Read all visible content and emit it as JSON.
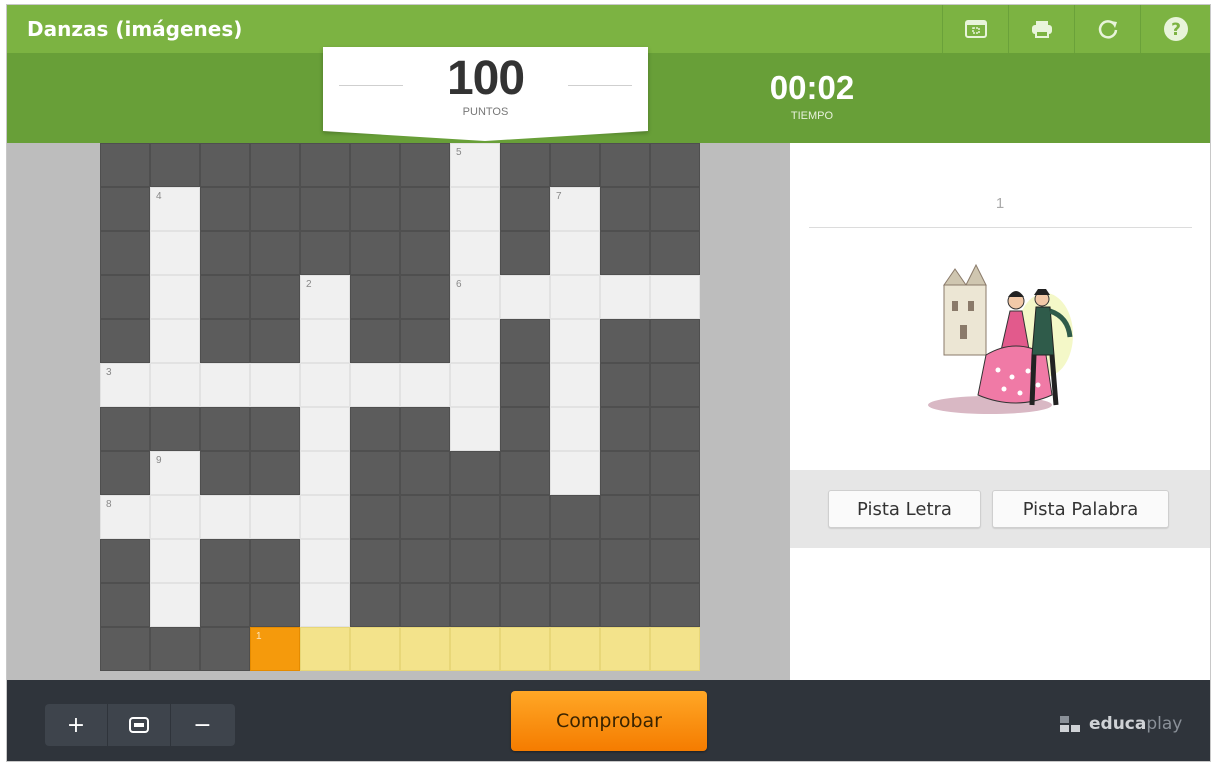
{
  "header": {
    "title": "Danzas (imágenes)",
    "buttons": [
      {
        "name": "fullscreen-icon"
      },
      {
        "name": "print-icon"
      },
      {
        "name": "restart-icon"
      },
      {
        "name": "help-icon"
      }
    ]
  },
  "score": {
    "value": "100",
    "label": "PUNTOS"
  },
  "timer": {
    "value": "00:02",
    "label": "TIEMPO"
  },
  "crossword": {
    "rows": 12,
    "cols": 12,
    "cells": [
      "bbbbbbbwbbbb",
      "bwbbbbbwbwbb",
      "bwbbbbbwbwbb",
      "bwbbwbbwwwww",
      "bwbbwbbwbwbb",
      "wwwwwwwwbwbb",
      "bbbbwbbwbwbb",
      "bwbbwbbbbwbb",
      "wwwwwbbbbbbb",
      "bwbbwbbbbbbb",
      "bwbbwbbbbbbb",
      "bbbahhhhhhhh"
    ],
    "numbers": [
      {
        "row": 0,
        "col": 7,
        "n": "5"
      },
      {
        "row": 1,
        "col": 1,
        "n": "4"
      },
      {
        "row": 1,
        "col": 9,
        "n": "7"
      },
      {
        "row": 3,
        "col": 4,
        "n": "2"
      },
      {
        "row": 3,
        "col": 7,
        "n": "6"
      },
      {
        "row": 5,
        "col": 0,
        "n": "3"
      },
      {
        "row": 7,
        "col": 1,
        "n": "9"
      },
      {
        "row": 8,
        "col": 0,
        "n": "8"
      },
      {
        "row": 11,
        "col": 3,
        "n": "1"
      }
    ]
  },
  "clue": {
    "number": "1",
    "image": "flamenco-dancers-illustration"
  },
  "hints": {
    "letter_label": "Pista Letra",
    "word_label": "Pista Palabra"
  },
  "footer": {
    "zoom_in": "+",
    "zoom_out": "−",
    "check_label": "Comprobar",
    "brand_part1": "educa",
    "brand_part2": "play"
  },
  "colors": {
    "title_bar": "#7cb342",
    "score_bar": "#689f38",
    "active_cell": "#f59a0c",
    "highlight_cell": "#f3e38b",
    "check_button": "#fb8c00",
    "footer": "#2f343b"
  }
}
